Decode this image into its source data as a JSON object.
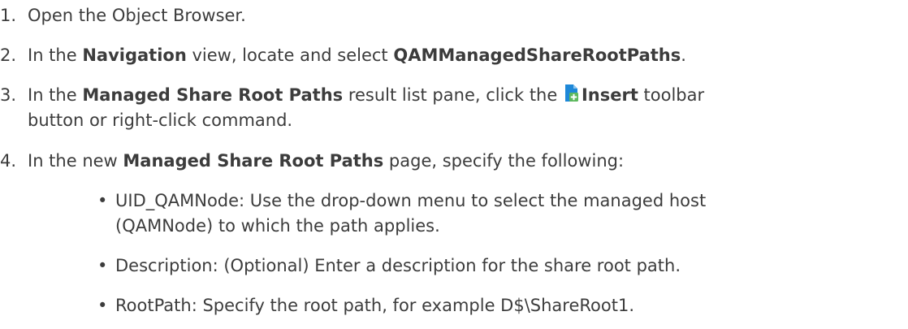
{
  "steps": [
    {
      "num": "1.",
      "text": "Open the Object Browser."
    },
    {
      "num": "2.",
      "pre": "In the ",
      "b1": "Navigation",
      "mid": " view, locate and select ",
      "b2": "QAMManagedShareRootPaths",
      "post": "."
    },
    {
      "num": "3.",
      "pre": "In the ",
      "b1": "Managed Share Root Paths",
      "mid": " result list pane, click the ",
      "b2": "Insert",
      "post": " toolbar",
      "line2": "button or right-click command.",
      "icon": "insert-icon"
    },
    {
      "num": "4.",
      "pre": "In the new ",
      "b1": "Managed Share Root Paths",
      "post": " page, specify the following:"
    }
  ],
  "bullets": [
    {
      "line1": "UID_QAMNode: Use the drop-down menu to select the managed host",
      "line2": "(QAMNode) to which the path applies."
    },
    {
      "line1": "Description: (Optional) Enter a description for the share root path."
    },
    {
      "line1": "RootPath: Specify the root path, for example D$\\ShareRoot1."
    }
  ],
  "colors": {
    "text": "#3c3c3c",
    "icon_doc": "#1e88d8",
    "icon_plus": "#5cb85c"
  }
}
